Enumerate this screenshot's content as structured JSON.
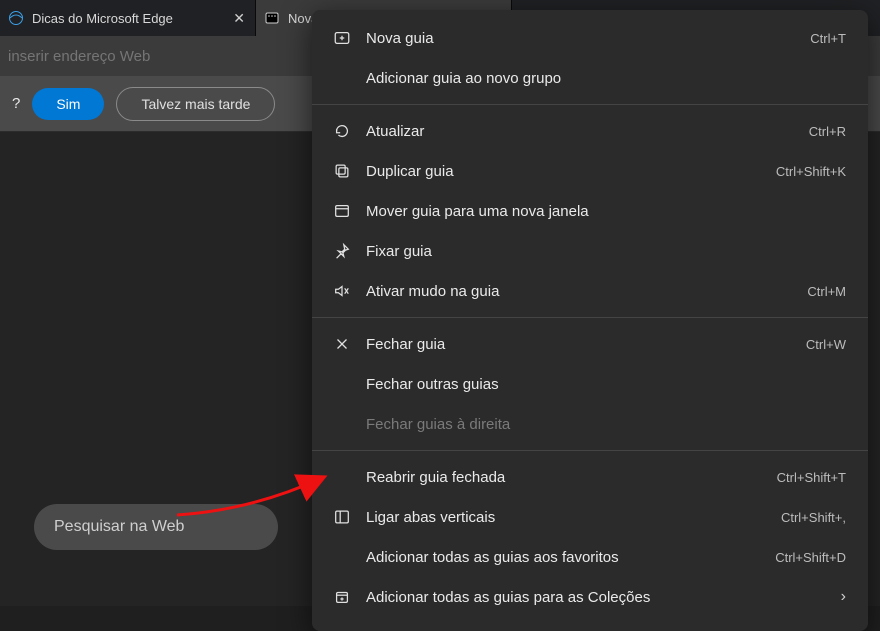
{
  "tabs": [
    {
      "title": "Dicas do Microsoft Edge"
    },
    {
      "title": "Nova guia"
    }
  ],
  "address_placeholder": "inserir endereço Web",
  "notification": {
    "question": "?",
    "yes": "Sim",
    "later": "Talvez mais tarde"
  },
  "search_pill": "Pesquisar na Web",
  "menu": {
    "items": [
      {
        "icon": "new-tab",
        "label": "Nova guia",
        "shortcut": "Ctrl+T"
      },
      {
        "icon": "",
        "label": "Adicionar guia ao novo grupo",
        "shortcut": ""
      },
      {
        "sep": true
      },
      {
        "icon": "refresh",
        "label": "Atualizar",
        "shortcut": "Ctrl+R"
      },
      {
        "icon": "duplicate",
        "label": "Duplicar guia",
        "shortcut": "Ctrl+Shift+K"
      },
      {
        "icon": "window",
        "label": "Mover guia para uma nova janela",
        "shortcut": ""
      },
      {
        "icon": "pin",
        "label": "Fixar guia",
        "shortcut": ""
      },
      {
        "icon": "mute",
        "label": "Ativar mudo na guia",
        "shortcut": "Ctrl+M"
      },
      {
        "sep": true
      },
      {
        "icon": "close",
        "label": "Fechar guia",
        "shortcut": "Ctrl+W"
      },
      {
        "icon": "",
        "label": "Fechar outras guias",
        "shortcut": ""
      },
      {
        "icon": "",
        "label": "Fechar guias à direita",
        "shortcut": "",
        "disabled": true
      },
      {
        "sep": true
      },
      {
        "icon": "",
        "label": "Reabrir guia fechada",
        "shortcut": "Ctrl+Shift+T"
      },
      {
        "icon": "vertical-tabs",
        "label": "Ligar abas verticais",
        "shortcut": "Ctrl+Shift+,"
      },
      {
        "icon": "",
        "label": "Adicionar todas as guias aos favoritos",
        "shortcut": "Ctrl+Shift+D"
      },
      {
        "icon": "collections",
        "label": "Adicionar todas as guias para as Coleções",
        "submenu": true
      }
    ]
  }
}
